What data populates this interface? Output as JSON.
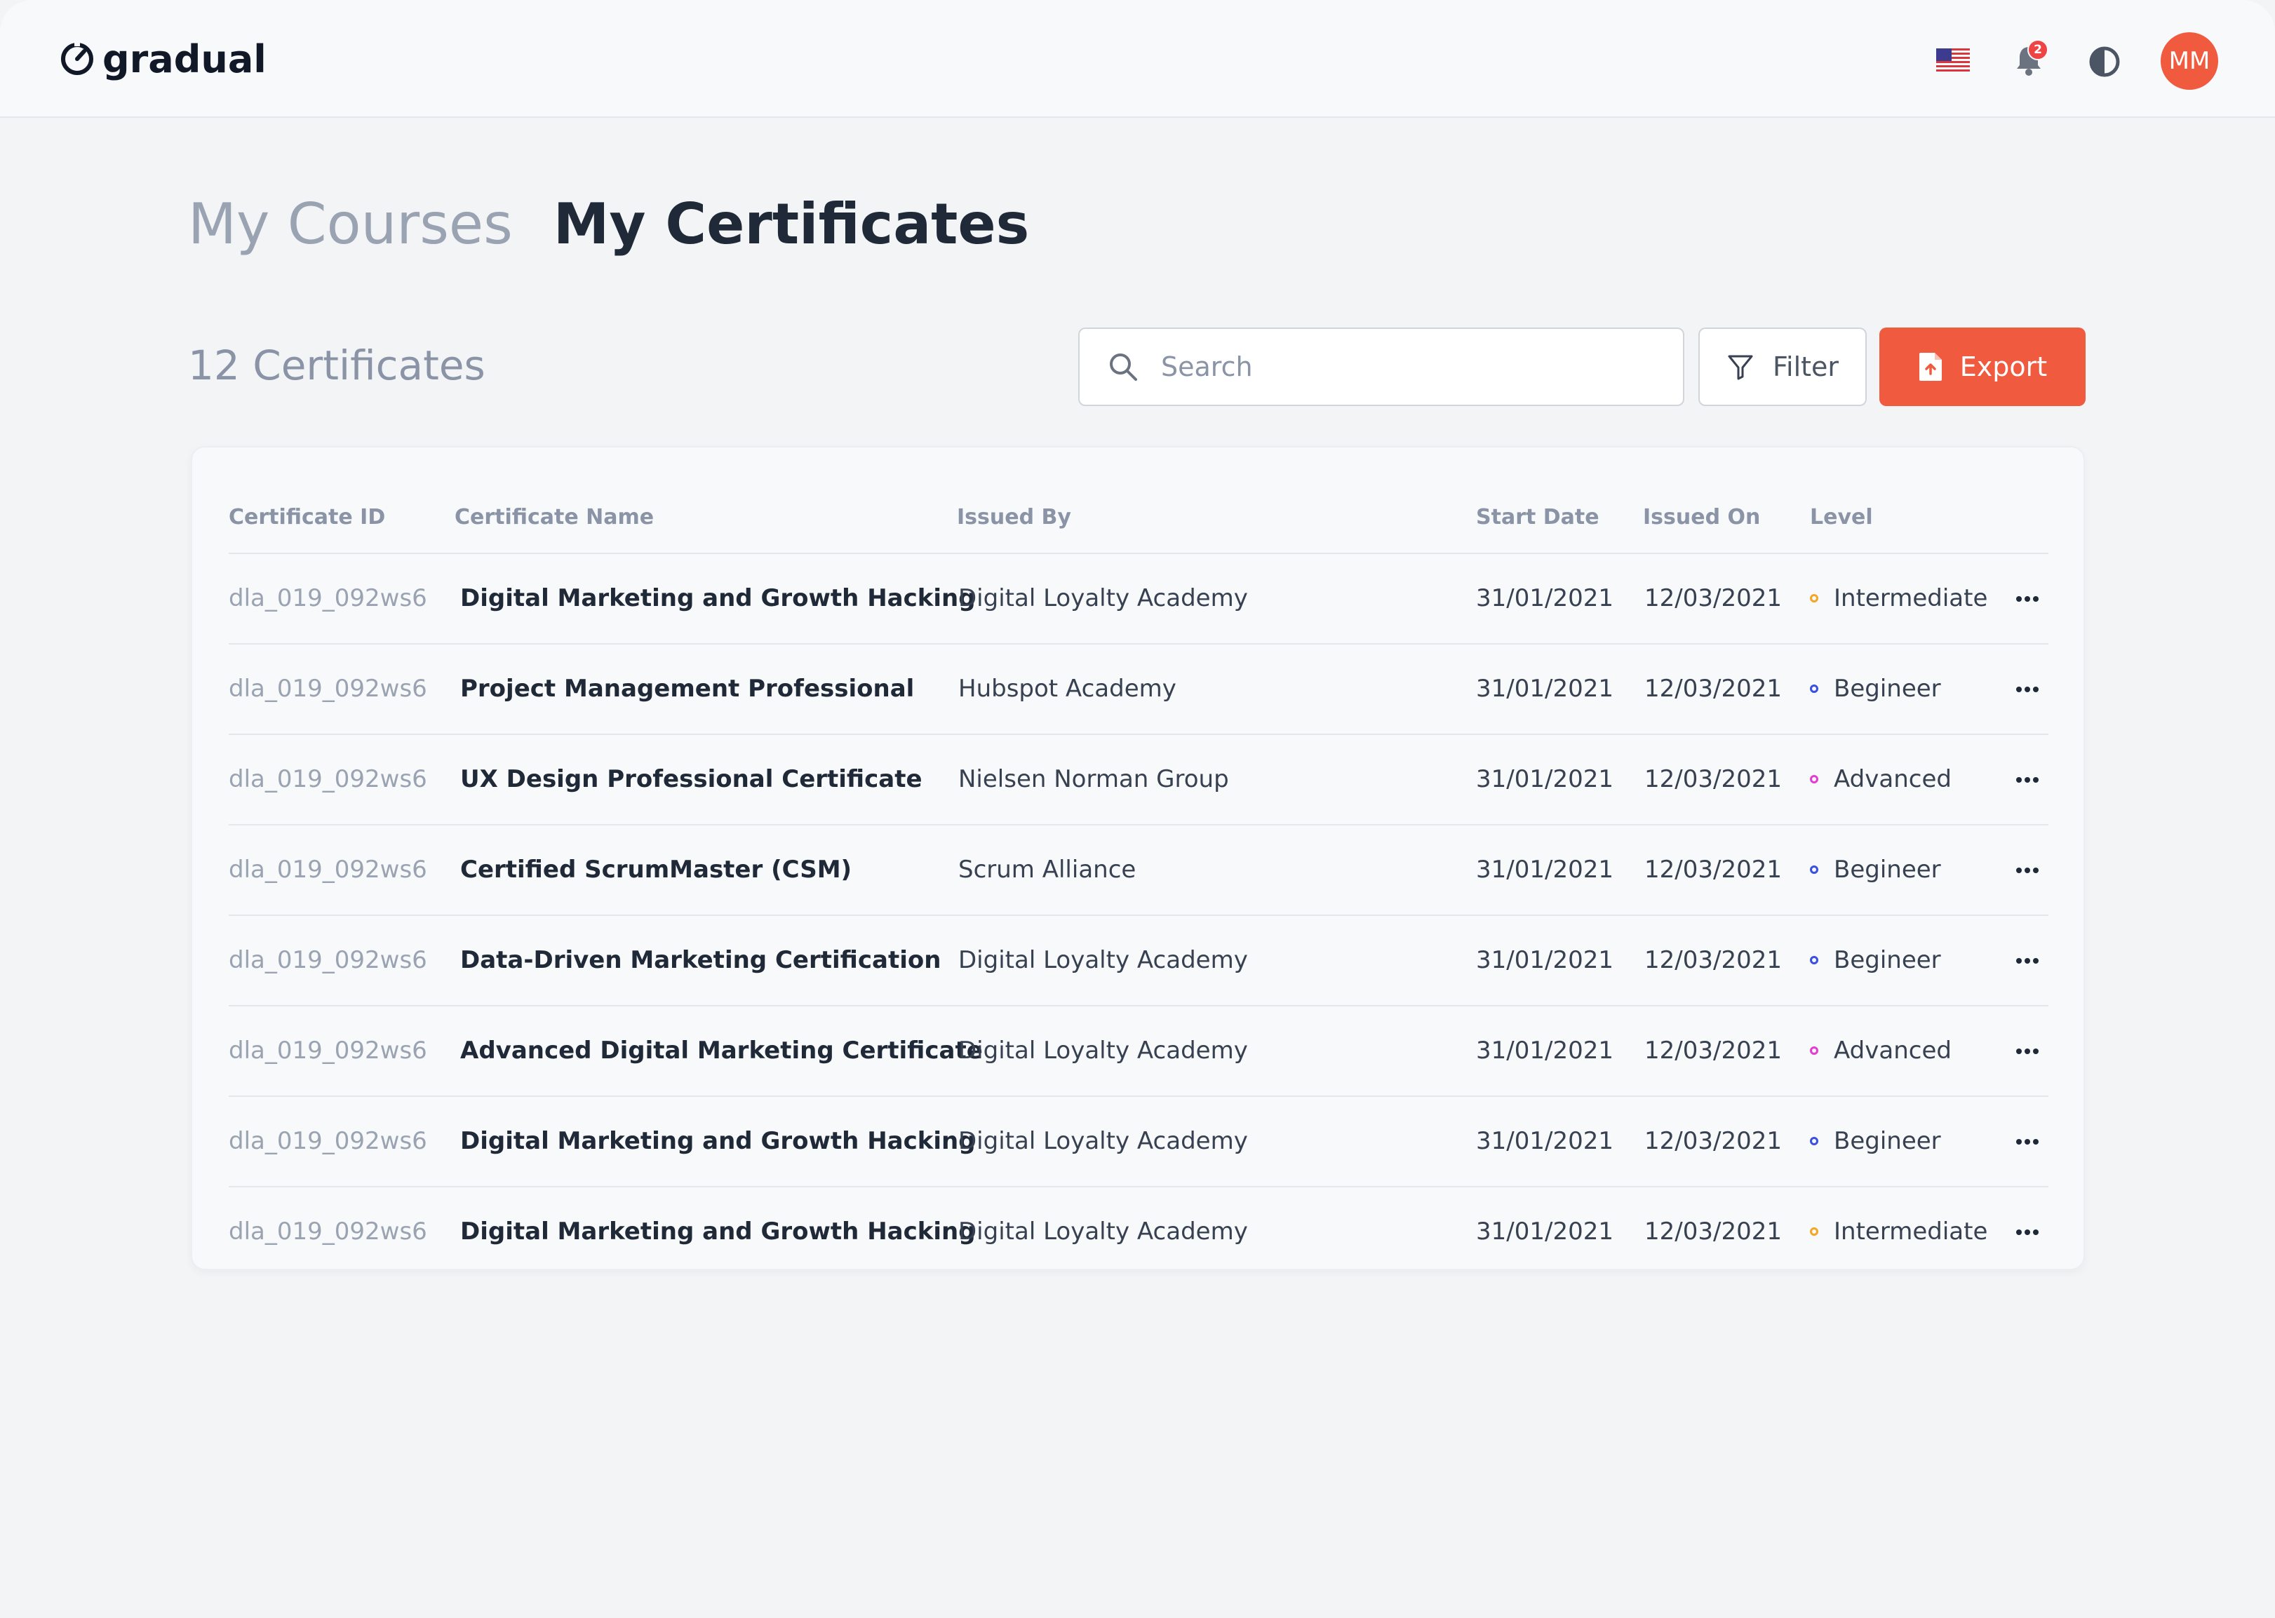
{
  "app": {
    "logo_text": "gradual"
  },
  "header": {
    "flag_icon": "us-flag-icon",
    "notifications_badge": "2",
    "avatar_initials": "MM"
  },
  "tabs": [
    {
      "label": "My Courses",
      "active": false
    },
    {
      "label": "My Certificates",
      "active": true
    }
  ],
  "toolbar": {
    "count_label": "12 Certificates",
    "search_placeholder": "Search",
    "search_value": "",
    "filter_label": "Filter",
    "export_label": "Export"
  },
  "colors": {
    "accent": "#f05a3f",
    "intermediate": "#f5a623",
    "begineer": "#3b4fe0",
    "advanced": "#e23fd0"
  },
  "table": {
    "headers": [
      "Certificate ID",
      "Certificate Name",
      "Issued By",
      "Start Date",
      "Issued On",
      "Level"
    ],
    "rows": [
      {
        "id": "dla_019_092ws6",
        "name": "Digital Marketing and Growth Hacking",
        "issuer": "Digital Loyalty Academy",
        "start": "31/01/2021",
        "issued": "12/03/2021",
        "level": "Intermediate"
      },
      {
        "id": "dla_019_092ws6",
        "name": "Project Management Professional",
        "issuer": "Hubspot Academy",
        "start": "31/01/2021",
        "issued": "12/03/2021",
        "level": "Begineer"
      },
      {
        "id": "dla_019_092ws6",
        "name": "UX Design Professional Certificate",
        "issuer": "Nielsen Norman Group",
        "start": "31/01/2021",
        "issued": "12/03/2021",
        "level": "Advanced"
      },
      {
        "id": "dla_019_092ws6",
        "name": "Certified ScrumMaster (CSM)",
        "issuer": "Scrum Alliance",
        "start": "31/01/2021",
        "issued": "12/03/2021",
        "level": "Begineer"
      },
      {
        "id": "dla_019_092ws6",
        "name": "Data-Driven Marketing Certification",
        "issuer": "Digital Loyalty Academy",
        "start": "31/01/2021",
        "issued": "12/03/2021",
        "level": "Begineer"
      },
      {
        "id": "dla_019_092ws6",
        "name": "Advanced Digital Marketing Certificate",
        "issuer": "Digital Loyalty Academy",
        "start": "31/01/2021",
        "issued": "12/03/2021",
        "level": "Advanced"
      },
      {
        "id": "dla_019_092ws6",
        "name": "Digital Marketing and Growth Hacking",
        "issuer": "Digital Loyalty Academy",
        "start": "31/01/2021",
        "issued": "12/03/2021",
        "level": "Begineer"
      },
      {
        "id": "dla_019_092ws6",
        "name": "Digital Marketing and Growth Hacking",
        "issuer": "Digital Loyalty Academy",
        "start": "31/01/2021",
        "issued": "12/03/2021",
        "level": "Intermediate"
      }
    ]
  }
}
